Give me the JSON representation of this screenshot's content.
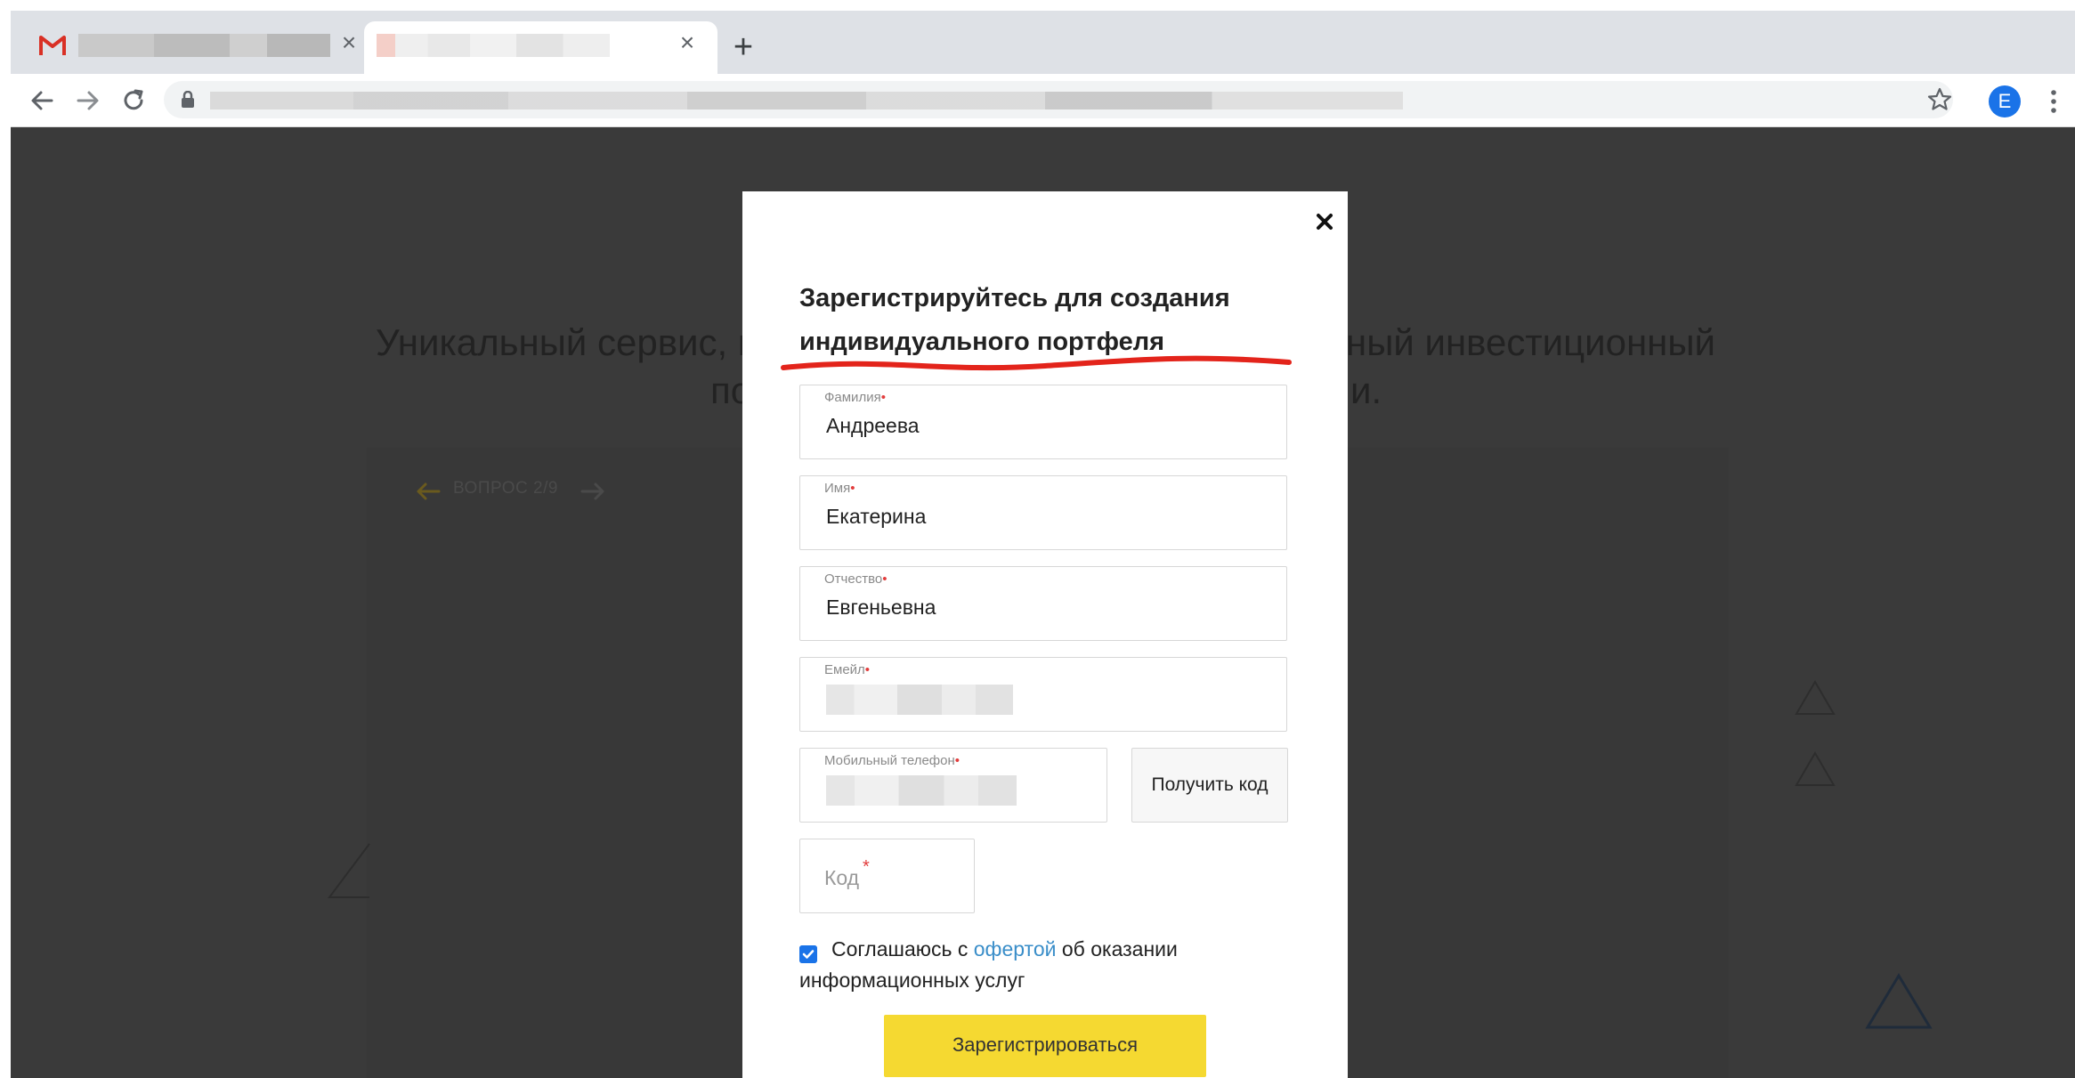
{
  "browser": {
    "new_tab_label": "+",
    "tab_close_glyph": "×",
    "avatar_initial": "E",
    "icons": [
      "gmail-icon",
      "close-icon",
      "back-arrow-icon",
      "forward-arrow-icon",
      "reload-icon",
      "lock-icon",
      "star-icon",
      "menu-dots-icon"
    ]
  },
  "page": {
    "hero_left": "Уникальный сервис, п",
    "hero_right": "ный инвестиционный",
    "hero_left2": "по",
    "hero_right2": "и.",
    "question_nav": "ВОПРОС 2/9"
  },
  "modal": {
    "close_glyph": "×",
    "title_line1": "Зарегистрируйтесь для создания",
    "title_line2": "индивидуального портфеля",
    "fields": [
      {
        "label": "Фамилия",
        "value": "Андреева"
      },
      {
        "label": "Имя",
        "value": "Екатерина"
      },
      {
        "label": "Отчество",
        "value": "Евгеньевна"
      },
      {
        "label": "Емейл",
        "value": ""
      },
      {
        "label": "Мобильный телефон",
        "value": ""
      }
    ],
    "required_mark": "•",
    "get_code_button": "Получить код",
    "code_placeholder": "Код",
    "code_required_mark": "*",
    "agree_prefix": "Соглашаюсь с ",
    "agree_link": "офертой",
    "agree_suffix": " об оказании",
    "agree_line2": "информационных услуг",
    "agree_checked": true,
    "submit_button": "Зарегистрироваться"
  },
  "colors": {
    "accent_yellow": "#f5d931",
    "link_blue": "#3a8ec9",
    "required_red": "#e23c3c",
    "overlay_dark": "#3a3a3a",
    "annotation_red": "#e3241b",
    "avatar_blue": "#1a73e8"
  }
}
